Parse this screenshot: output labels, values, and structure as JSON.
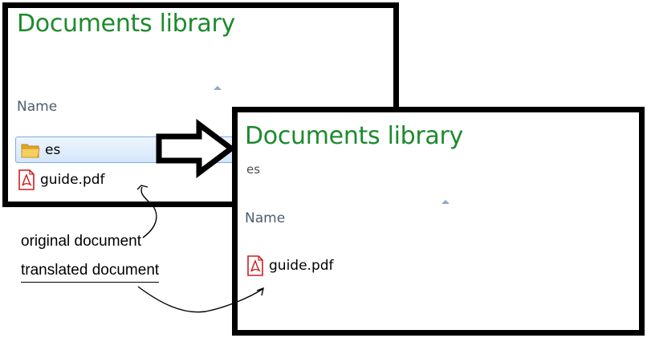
{
  "left_window": {
    "title": "Documents library",
    "column_header": "Name",
    "items": [
      {
        "label": "es",
        "icon": "folder-icon",
        "selected": true
      },
      {
        "label": "guide.pdf",
        "icon": "pdf-file-icon",
        "selected": false
      }
    ]
  },
  "right_window": {
    "title": "Documents library",
    "subtitle": "es",
    "column_header": "Name",
    "items": [
      {
        "label": "guide.pdf",
        "icon": "pdf-file-icon"
      }
    ]
  },
  "annotations": {
    "original": "original document",
    "translated": "translated document"
  },
  "colors": {
    "title_green": "#1e8a2e",
    "frame": "#000000",
    "selection_border": "#84acdd",
    "pdf_red": "#cc2020",
    "folder_yellow": "#e8b830"
  }
}
